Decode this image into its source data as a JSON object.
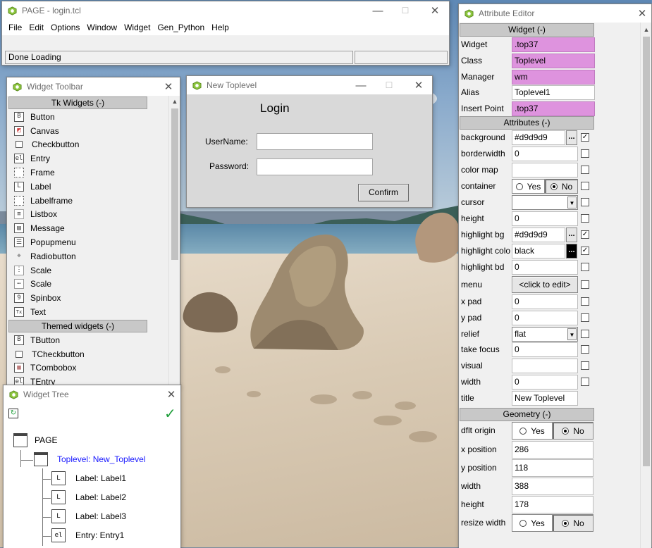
{
  "colors": {
    "tk_bg": "#d9d9d9",
    "pink_field": "#de93de",
    "link_blue": "#1a1aff",
    "check_green": "#1e9e3a"
  },
  "main": {
    "title": "PAGE - login.tcl",
    "menu": [
      "File",
      "Edit",
      "Options",
      "Window",
      "Widget",
      "Gen_Python",
      "Help"
    ],
    "status": "Done Loading"
  },
  "toolbar": {
    "title": "Widget Toolbar",
    "tk_section": "Tk Widgets (-)",
    "tk_items": [
      {
        "label": "Button",
        "icon": "button-icon"
      },
      {
        "label": "Canvas",
        "icon": "canvas-icon"
      },
      {
        "label": "Checkbutton",
        "icon": "checkbutton-icon"
      },
      {
        "label": "Entry",
        "icon": "entry-icon"
      },
      {
        "label": "Frame",
        "icon": "frame-icon"
      },
      {
        "label": "Label",
        "icon": "label-icon"
      },
      {
        "label": "Labelframe",
        "icon": "labelframe-icon"
      },
      {
        "label": "Listbox",
        "icon": "listbox-icon"
      },
      {
        "label": "Message",
        "icon": "message-icon"
      },
      {
        "label": "Popupmenu",
        "icon": "popupmenu-icon"
      },
      {
        "label": "Radiobutton",
        "icon": "radiobutton-icon"
      },
      {
        "label": "Scale",
        "icon": "vertical-scale-icon"
      },
      {
        "label": "Scale",
        "icon": "horizontal-scale-icon"
      },
      {
        "label": "Spinbox",
        "icon": "spinbox-icon"
      },
      {
        "label": "Text",
        "icon": "text-icon"
      }
    ],
    "themed_section": "Themed widgets (-)",
    "themed_items": [
      {
        "label": "TButton",
        "icon": "tbutton-icon"
      },
      {
        "label": "TCheckbutton",
        "icon": "tcheckbutton-icon"
      },
      {
        "label": "TCombobox",
        "icon": "tcombobox-icon"
      },
      {
        "label": "TEntry",
        "icon": "tentry-icon"
      }
    ]
  },
  "toplevel": {
    "title": "New Toplevel",
    "heading": "Login",
    "username_label": "UserName:",
    "password_label": "Password:",
    "confirm_label": "Confirm"
  },
  "tree": {
    "title": "Widget Tree",
    "nodes": [
      {
        "label": "PAGE"
      },
      {
        "label": "Toplevel: New_Toplevel"
      },
      {
        "label": "Label: Label1"
      },
      {
        "label": "Label: Label2"
      },
      {
        "label": "Label: Label3"
      },
      {
        "label": "Entry: Entry1"
      }
    ]
  },
  "attr": {
    "title": "Attribute Editor",
    "widget_section": "Widget (-)",
    "widget_rows": [
      {
        "label": "Widget",
        "value": ".top37"
      },
      {
        "label": "Class",
        "value": "Toplevel"
      },
      {
        "label": "Manager",
        "value": "wm"
      },
      {
        "label": "Alias",
        "value": "Toplevel1"
      },
      {
        "label": "Insert Point",
        "value": ".top37"
      }
    ],
    "attributes_section": "Attributes (-)",
    "rows": {
      "background": {
        "label": "background",
        "value": "#d9d9d9",
        "dots": "...",
        "check": "✓"
      },
      "borderwidth": {
        "label": "borderwidth",
        "value": "0"
      },
      "colormap": {
        "label": "color map",
        "value": ""
      },
      "container": {
        "label": "container",
        "yes": "Yes",
        "no": "No"
      },
      "cursor": {
        "label": "cursor",
        "value": ""
      },
      "height": {
        "label": "height",
        "value": "0"
      },
      "highlightbg": {
        "label": "highlight bg",
        "value": "#d9d9d9",
        "dots": "...",
        "check": "✓"
      },
      "highlightcolor": {
        "label": "highlight colo",
        "value": "black",
        "dots": "...",
        "check": "✓"
      },
      "highlightbd": {
        "label": "highlight bd",
        "value": "0"
      },
      "menu": {
        "label": "menu",
        "value": "<click to edit>"
      },
      "xpad": {
        "label": "x pad",
        "value": "0"
      },
      "ypad": {
        "label": "y pad",
        "value": "0"
      },
      "relief": {
        "label": "relief",
        "value": "flat"
      },
      "takefocus": {
        "label": "take focus",
        "value": "0"
      },
      "visual": {
        "label": "visual",
        "value": ""
      },
      "width": {
        "label": "width",
        "value": "0"
      },
      "title": {
        "label": "title",
        "value": "New Toplevel"
      }
    },
    "geometry_section": "Geometry (-)",
    "geo": {
      "dflt_origin": {
        "label": "dflt origin",
        "yes": "Yes",
        "no": "No"
      },
      "x_position": {
        "label": "x position",
        "value": "286"
      },
      "y_position": {
        "label": "y position",
        "value": "118"
      },
      "width": {
        "label": "width",
        "value": "388"
      },
      "height": {
        "label": "height",
        "value": "178"
      },
      "resize_width": {
        "label": "resize width",
        "yes": "Yes",
        "no": "No"
      }
    }
  }
}
